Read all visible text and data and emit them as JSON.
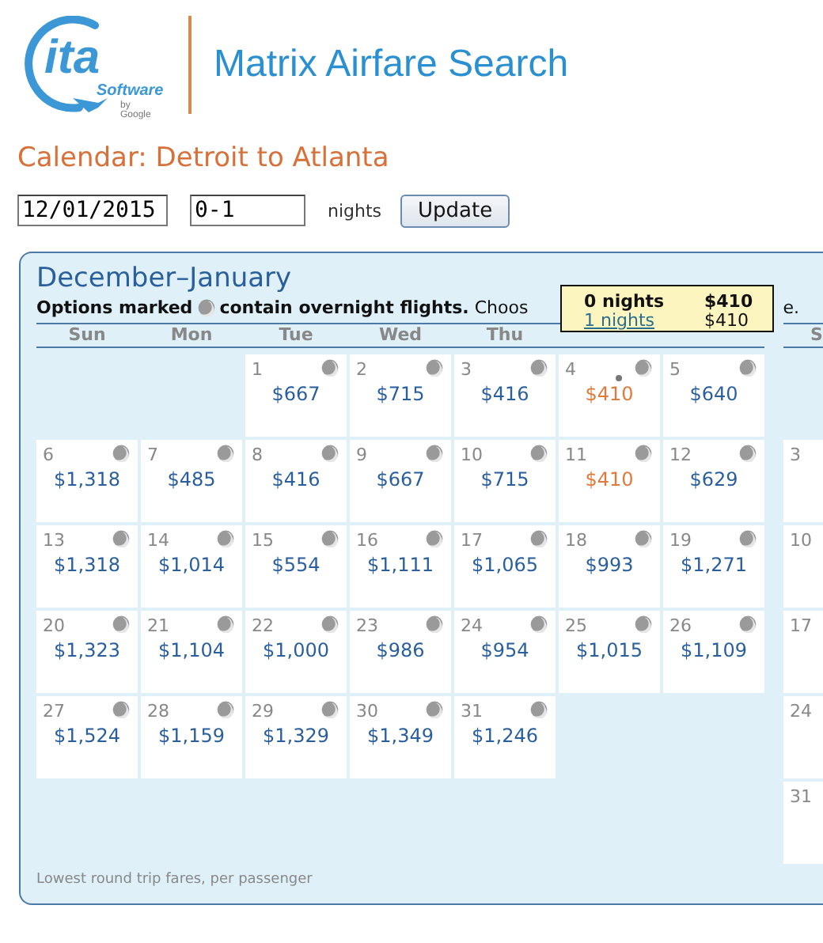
{
  "logo": {
    "mark": "ita",
    "name": "Software",
    "byline": "by Google"
  },
  "app_title": "Matrix Airfare Search",
  "heading": "Calendar: Detroit to Atlanta",
  "form": {
    "date": "12/01/2015",
    "nights": "0-1",
    "nights_label": "nights",
    "button": "Update"
  },
  "calendar": {
    "title": "December–January",
    "legend_before": "Options marked",
    "legend_after": "**contain overnight flights.** Choos",
    "legend_tail": "e.",
    "months": [
      {
        "weekdays": [
          "Sun",
          "Mon",
          "Tue",
          "Wed",
          "Thu"
        ],
        "weeks": [
          [
            {
              "kind": "blank"
            },
            {
              "kind": "blank"
            },
            {
              "kind": "day",
              "day": "1",
              "price": "$667",
              "overnight": true,
              "cheapest": false,
              "selected": false
            },
            {
              "kind": "day",
              "day": "2",
              "price": "$715",
              "overnight": true,
              "cheapest": false,
              "selected": false
            },
            {
              "kind": "day",
              "day": "3",
              "price": "$416",
              "overnight": true,
              "cheapest": false,
              "selected": false
            },
            {
              "kind": "day",
              "day": "4",
              "price": "$410",
              "overnight": true,
              "cheapest": true,
              "selected": true
            },
            {
              "kind": "day",
              "day": "5",
              "price": "$640",
              "overnight": true,
              "cheapest": false,
              "selected": false
            }
          ],
          [
            {
              "kind": "day",
              "day": "6",
              "price": "$1,318",
              "overnight": true,
              "cheapest": false,
              "selected": false
            },
            {
              "kind": "day",
              "day": "7",
              "price": "$485",
              "overnight": true,
              "cheapest": false,
              "selected": false
            },
            {
              "kind": "day",
              "day": "8",
              "price": "$416",
              "overnight": true,
              "cheapest": false,
              "selected": false
            },
            {
              "kind": "day",
              "day": "9",
              "price": "$667",
              "overnight": true,
              "cheapest": false,
              "selected": false
            },
            {
              "kind": "day",
              "day": "10",
              "price": "$715",
              "overnight": true,
              "cheapest": false,
              "selected": false
            },
            {
              "kind": "day",
              "day": "11",
              "price": "$410",
              "overnight": true,
              "cheapest": true,
              "selected": false
            },
            {
              "kind": "day",
              "day": "12",
              "price": "$629",
              "overnight": true,
              "cheapest": false,
              "selected": false
            }
          ],
          [
            {
              "kind": "day",
              "day": "13",
              "price": "$1,318",
              "overnight": true,
              "cheapest": false,
              "selected": false
            },
            {
              "kind": "day",
              "day": "14",
              "price": "$1,014",
              "overnight": true,
              "cheapest": false,
              "selected": false
            },
            {
              "kind": "day",
              "day": "15",
              "price": "$554",
              "overnight": true,
              "cheapest": false,
              "selected": false
            },
            {
              "kind": "day",
              "day": "16",
              "price": "$1,111",
              "overnight": true,
              "cheapest": false,
              "selected": false
            },
            {
              "kind": "day",
              "day": "17",
              "price": "$1,065",
              "overnight": true,
              "cheapest": false,
              "selected": false
            },
            {
              "kind": "day",
              "day": "18",
              "price": "$993",
              "overnight": true,
              "cheapest": false,
              "selected": false
            },
            {
              "kind": "day",
              "day": "19",
              "price": "$1,271",
              "overnight": true,
              "cheapest": false,
              "selected": false
            }
          ],
          [
            {
              "kind": "day",
              "day": "20",
              "price": "$1,323",
              "overnight": true,
              "cheapest": false,
              "selected": false
            },
            {
              "kind": "day",
              "day": "21",
              "price": "$1,104",
              "overnight": true,
              "cheapest": false,
              "selected": false
            },
            {
              "kind": "day",
              "day": "22",
              "price": "$1,000",
              "overnight": true,
              "cheapest": false,
              "selected": false
            },
            {
              "kind": "day",
              "day": "23",
              "price": "$986",
              "overnight": true,
              "cheapest": false,
              "selected": false
            },
            {
              "kind": "day",
              "day": "24",
              "price": "$954",
              "overnight": true,
              "cheapest": false,
              "selected": false
            },
            {
              "kind": "day",
              "day": "25",
              "price": "$1,015",
              "overnight": true,
              "cheapest": false,
              "selected": false
            },
            {
              "kind": "day",
              "day": "26",
              "price": "$1,109",
              "overnight": true,
              "cheapest": false,
              "selected": false
            }
          ],
          [
            {
              "kind": "day",
              "day": "27",
              "price": "$1,524",
              "overnight": true,
              "cheapest": false,
              "selected": false
            },
            {
              "kind": "day",
              "day": "28",
              "price": "$1,159",
              "overnight": true,
              "cheapest": false,
              "selected": false
            },
            {
              "kind": "day",
              "day": "29",
              "price": "$1,329",
              "overnight": true,
              "cheapest": false,
              "selected": false
            },
            {
              "kind": "day",
              "day": "30",
              "price": "$1,349",
              "overnight": true,
              "cheapest": false,
              "selected": false
            },
            {
              "kind": "day",
              "day": "31",
              "price": "$1,246",
              "overnight": true,
              "cheapest": false,
              "selected": false
            }
          ]
        ]
      },
      {
        "weekdays": [
          "S"
        ],
        "weeks": [
          [
            {
              "kind": "blank"
            }
          ],
          [
            {
              "kind": "day",
              "day": "3"
            }
          ],
          [
            {
              "kind": "day",
              "day": "10"
            }
          ],
          [
            {
              "kind": "day",
              "day": "17"
            }
          ],
          [
            {
              "kind": "day",
              "day": "24"
            }
          ],
          [
            {
              "kind": "day",
              "day": "31"
            }
          ]
        ]
      }
    ],
    "footnote": "Lowest round trip fares, per passenger"
  },
  "tooltip": {
    "rows": [
      {
        "nights": "0 nights",
        "price": "$410",
        "current": true
      },
      {
        "nights": "1 nights",
        "price": "$410",
        "current": false
      }
    ]
  }
}
